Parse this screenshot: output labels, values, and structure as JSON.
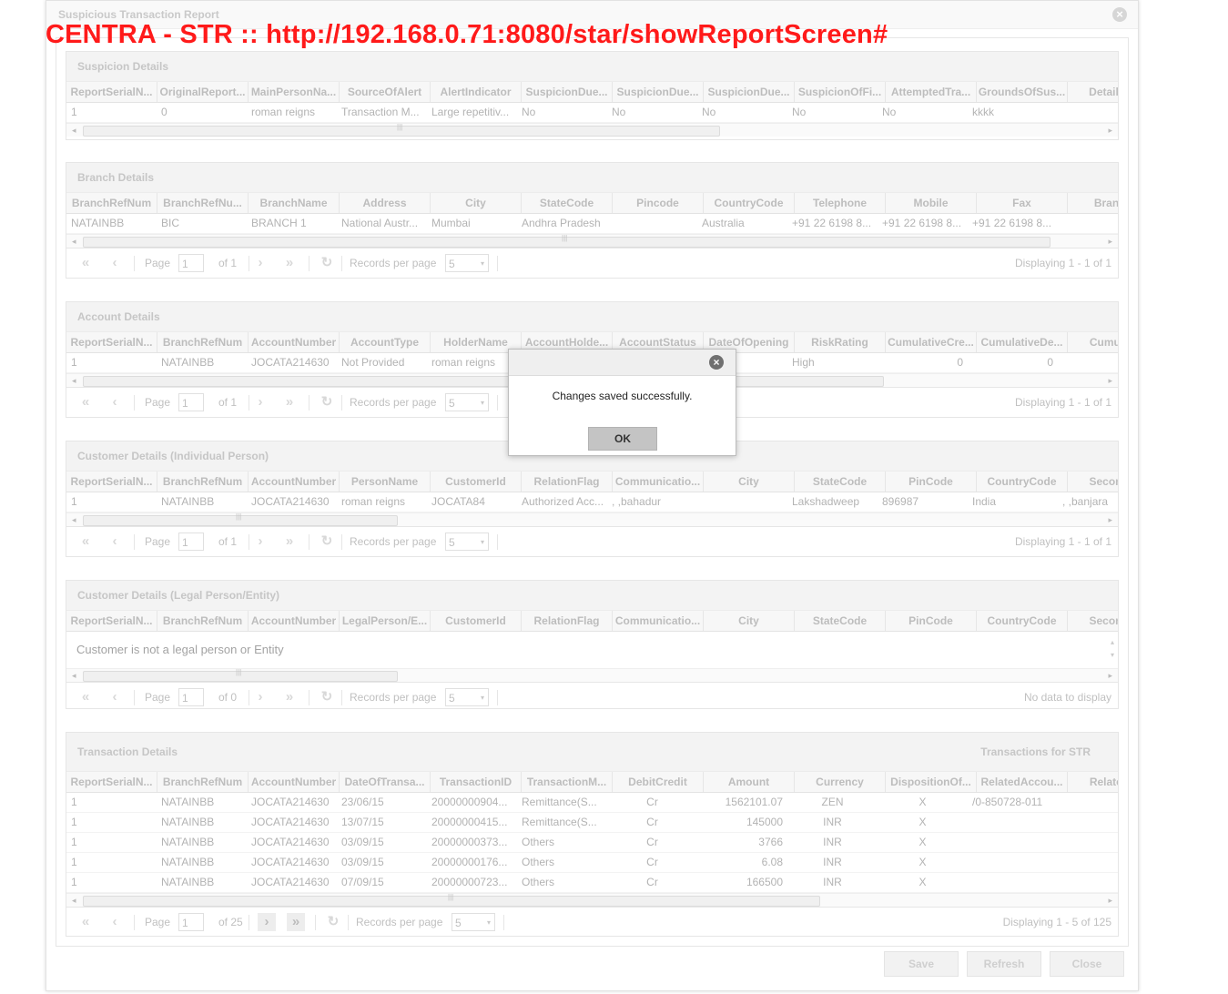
{
  "window": {
    "title": "Suspicious Transaction Report"
  },
  "banner": {
    "text": "CENTRA - STR :: http://192.168.0.71:8080/star/showReportScreen#"
  },
  "pager_labels": {
    "page": "Page",
    "records_per_page": "Records per page"
  },
  "panels": {
    "suspicion": {
      "title": "Suspicion Details",
      "columns": [
        "ReportSerialN...",
        "OriginalReport...",
        "MainPersonNa...",
        "SourceOfAlert",
        "AlertIndicator",
        "SuspicionDue...",
        "SuspicionDue...",
        "SuspicionDue...",
        "SuspicionOfFi...",
        "AttemptedTra...",
        "GroundsOfSus...",
        "DetailsOf"
      ],
      "rows": [
        [
          "1",
          "0",
          "roman reigns",
          "Transaction M...",
          "Large repetitiv...",
          "No",
          "No",
          "No",
          "No",
          "No",
          "kkkk",
          ""
        ]
      ]
    },
    "branch": {
      "title": "Branch Details",
      "columns": [
        "BranchRefNum",
        "BranchRefNu...",
        "BranchName",
        "Address",
        "City",
        "StateCode",
        "Pincode",
        "CountryCode",
        "Telephone",
        "Mobile",
        "Fax",
        "Branch"
      ],
      "rows": [
        [
          "NATAINBB",
          "BIC",
          "BRANCH 1",
          "National Austr...",
          "Mumbai",
          "Andhra Pradesh",
          "",
          "Australia",
          "+91 22 6198 8...",
          "+91 22 6198 8...",
          "+91 22 6198 8...",
          ""
        ]
      ],
      "pager": {
        "page": "1",
        "of": "of 1",
        "per_page": "5",
        "display": "Displaying 1 - 1 of 1"
      }
    },
    "account": {
      "title": "Account Details",
      "columns": [
        "ReportSerialN...",
        "BranchRefNum",
        "AccountNumber",
        "AccountType",
        "HolderName",
        "AccountHolde...",
        "AccountStatus",
        "DateOfOpening",
        "RiskRating",
        "CumulativeCre...",
        "CumulativeDe...",
        "Cumulati"
      ],
      "rows": [
        [
          "1",
          "NATAINBB",
          "JOCATA214630",
          "Not Provided",
          "roman reigns",
          "",
          "",
          "-05-11",
          "High",
          "0",
          "0",
          ""
        ]
      ],
      "pager": {
        "page": "1",
        "of": "of 1",
        "per_page": "5",
        "display": "Displaying 1 - 1 of 1"
      }
    },
    "customer_individual": {
      "title": "Customer Details (Individual Person)",
      "columns": [
        "ReportSerialN...",
        "BranchRefNum",
        "AccountNumber",
        "PersonName",
        "CustomerId",
        "RelationFlag",
        "Communicatio...",
        "City",
        "StateCode",
        "PinCode",
        "CountryCode",
        "SecondA"
      ],
      "rows": [
        [
          "1",
          "NATAINBB",
          "JOCATA214630",
          "roman reigns",
          "JOCATA84",
          "Authorized Acc...",
          ", ,bahadur",
          "",
          "Lakshadweep",
          "896987",
          "India",
          ", ,banjara"
        ]
      ],
      "pager": {
        "page": "1",
        "of": "of 1",
        "per_page": "5",
        "display": "Displaying 1 - 1 of 1"
      }
    },
    "customer_legal": {
      "title": "Customer Details (Legal Person/Entity)",
      "columns": [
        "ReportSerialN...",
        "BranchRefNum",
        "AccountNumber",
        "LegalPerson/E...",
        "CustomerId",
        "RelationFlag",
        "Communicatio...",
        "City",
        "StateCode",
        "PinCode",
        "CountryCode",
        "SecondA"
      ],
      "empty_message": "Customer is not a legal person or Entity",
      "pager": {
        "page": "1",
        "of": "of 0",
        "per_page": "5",
        "display": "No data to display"
      }
    },
    "transaction": {
      "title": "Transaction Details",
      "right_title": "Transactions for STR",
      "columns": [
        "ReportSerialN...",
        "BranchRefNum",
        "AccountNumber",
        "DateOfTransa...",
        "TransactionID",
        "TransactionM...",
        "DebitCredit",
        "Amount",
        "Currency",
        "DispositionOf...",
        "RelatedAccou...",
        "RelatedIr"
      ],
      "rows": [
        [
          "1",
          "NATAINBB",
          "JOCATA214630",
          "23/06/15",
          "20000000904...",
          "Remittance(S...",
          "Cr",
          "1562101.07",
          "ZEN",
          "X",
          "/0-850728-011",
          ""
        ],
        [
          "1",
          "NATAINBB",
          "JOCATA214630",
          "13/07/15",
          "20000000415...",
          "Remittance(S...",
          "Cr",
          "145000",
          "INR",
          "X",
          "",
          ""
        ],
        [
          "1",
          "NATAINBB",
          "JOCATA214630",
          "03/09/15",
          "20000000373...",
          "Others",
          "Cr",
          "3766",
          "INR",
          "X",
          "",
          ""
        ],
        [
          "1",
          "NATAINBB",
          "JOCATA214630",
          "03/09/15",
          "20000000176...",
          "Others",
          "Cr",
          "6.08",
          "INR",
          "X",
          "",
          ""
        ],
        [
          "1",
          "NATAINBB",
          "JOCATA214630",
          "07/09/15",
          "20000000723...",
          "Others",
          "Cr",
          "166500",
          "INR",
          "X",
          "",
          ""
        ]
      ],
      "pager": {
        "page": "1",
        "of": "of 25",
        "per_page": "5",
        "display": "Displaying 1 - 5 of 125"
      }
    }
  },
  "footer": {
    "save": "Save",
    "refresh": "Refresh",
    "close": "Close"
  },
  "dialog": {
    "message": "Changes saved successfully.",
    "ok": "OK"
  }
}
